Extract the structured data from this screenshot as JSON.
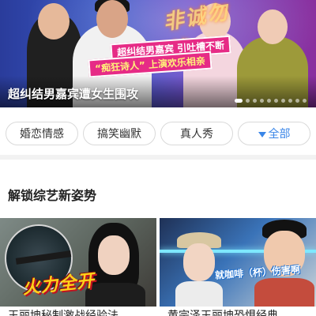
{
  "banner": {
    "title": "超纠结男嘉宾遭女生围攻",
    "logo_text": "非诚勿扰",
    "caption_line1": "超纠结男嘉宾 引吐槽不断",
    "caption_line2": "“痴狂诗人” 上演欢乐相亲",
    "page_count": 10,
    "active_page": 1
  },
  "tags": [
    {
      "label": "婚恋情感"
    },
    {
      "label": "搞笑幽默"
    },
    {
      "label": "真人秀"
    },
    {
      "label": "全部"
    }
  ],
  "accent_color": "#3a86e8",
  "section": {
    "title": "解锁综艺新姿势"
  },
  "videos": [
    {
      "overlay_text": "火力全开",
      "caption": "王丽坤秘制激战经验法"
    },
    {
      "overlay_text": "就咖啡（杯）伤害啊",
      "caption": "黄宗泽王丽坤恐惧经典"
    }
  ]
}
